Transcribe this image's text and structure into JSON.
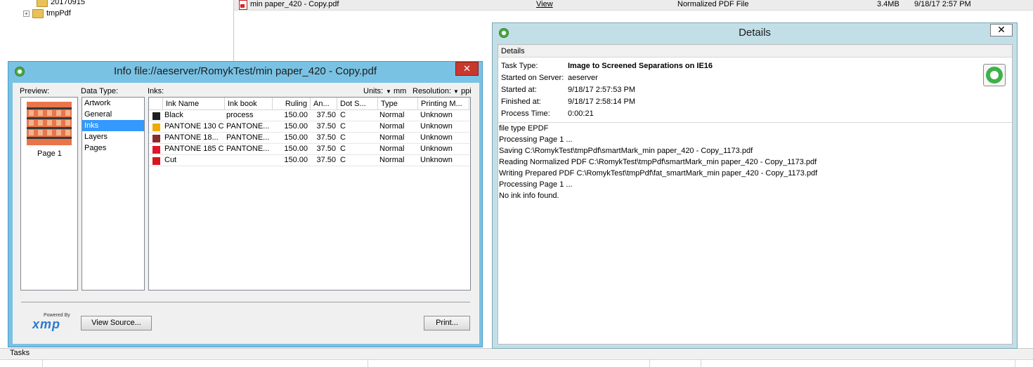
{
  "background": {
    "tree": [
      {
        "label": "20170915"
      },
      {
        "label": "tmpPdf"
      }
    ],
    "file_row": {
      "name": "min paper_420 - Copy.pdf",
      "view": "View",
      "type": "Normalized PDF File",
      "size": "3.4MB",
      "date": "9/18/17 2:57 PM"
    },
    "tasks_label": "Tasks"
  },
  "info_window": {
    "title": "Info file://aeserver/RomykTest/min paper_420 - Copy.pdf",
    "close": "✕",
    "preview_label": "Preview:",
    "page_label": "Page 1",
    "datatype_label": "Data Type:",
    "datatypes": [
      "Artwork",
      "General",
      "Inks",
      "Layers",
      "Pages"
    ],
    "datatype_selected": "Inks",
    "inks_label": "Inks:",
    "units_label": "Units:",
    "units_value": "mm",
    "resolution_label": "Resolution:",
    "resolution_value": "ppi",
    "columns": [
      "",
      "Ink Name",
      "Ink book",
      "Ruling",
      "An...",
      "Dot S...",
      "Type",
      "Printing M..."
    ],
    "inks": [
      {
        "color": "#1e1e1e",
        "name": "Black",
        "book": "process",
        "ruling": "150.00",
        "angle": "37.50",
        "dot": "C",
        "type": "Normal",
        "printing": "Unknown"
      },
      {
        "color": "#f2a900",
        "name": "PANTONE 130 C",
        "book": "PANTONE...",
        "ruling": "150.00",
        "angle": "37.50",
        "dot": "C",
        "type": "Normal",
        "printing": "Unknown"
      },
      {
        "color": "#8b2b2e",
        "name": "PANTONE 18...",
        "book": "PANTONE...",
        "ruling": "150.00",
        "angle": "37.50",
        "dot": "C",
        "type": "Normal",
        "printing": "Unknown"
      },
      {
        "color": "#e3142b",
        "name": "PANTONE 185 C",
        "book": "PANTONE...",
        "ruling": "150.00",
        "angle": "37.50",
        "dot": "C",
        "type": "Normal",
        "printing": "Unknown"
      },
      {
        "color": "#d9141e",
        "name": "Cut",
        "book": "",
        "ruling": "150.00",
        "angle": "37.50",
        "dot": "C",
        "type": "Normal",
        "printing": "Unknown"
      }
    ],
    "xmp_powered": "Powered By",
    "xmp_logo": "xmp",
    "view_source_button": "View Source...",
    "print_button": "Print..."
  },
  "details_window": {
    "title": "Details",
    "close": "✕",
    "section_header": "Details",
    "fields": [
      {
        "key": "Task Type:",
        "value": "Image to Screened Separations on IE16",
        "bold": true
      },
      {
        "key": "Started on Server:",
        "value": "aeserver"
      },
      {
        "key": "Started at:",
        "value": "9/18/17 2:57:53 PM"
      },
      {
        "key": "Finished at:",
        "value": "9/18/17 2:58:14 PM"
      },
      {
        "key": "Process Time:",
        "value": "0:00:21"
      }
    ],
    "log": [
      "file type EPDF",
      "Processing Page 1 ...",
      "Saving C:\\RomykTest\\tmpPdf\\smartMark_min paper_420 - Copy_1173.pdf",
      "Reading Normalized PDF C:\\RomykTest\\tmpPdf\\smartMark_min paper_420 - Copy_1173.pdf",
      "Writing Prepared PDF C:\\RomykTest\\tmpPdf\\fat_smartMark_min paper_420 - Copy_1173.pdf",
      "Processing Page 1 ...",
      "No ink info found."
    ]
  }
}
